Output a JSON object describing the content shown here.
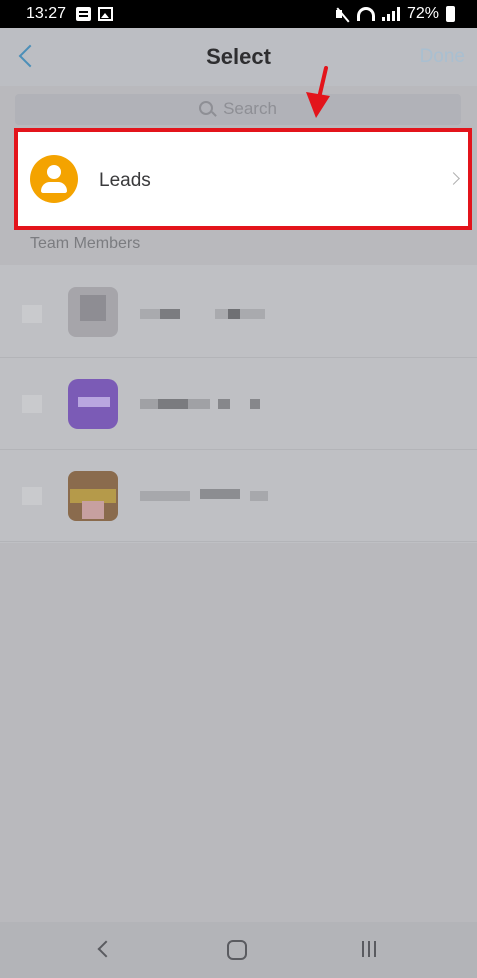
{
  "status_bar": {
    "time": "13:27",
    "battery": "72%"
  },
  "header": {
    "title": "Select",
    "done_label": "Done",
    "back_icon": "chevron-left-icon"
  },
  "search": {
    "placeholder": "Search",
    "icon": "search-icon"
  },
  "leads_item": {
    "label": "Leads",
    "icon": "person-icon",
    "highlight_color": "#e3141b",
    "avatar_color": "#f4a300"
  },
  "team_section": {
    "header": "Team Members"
  },
  "colors": {
    "accent": "#4c8fb8",
    "annotation": "#e3141b"
  }
}
